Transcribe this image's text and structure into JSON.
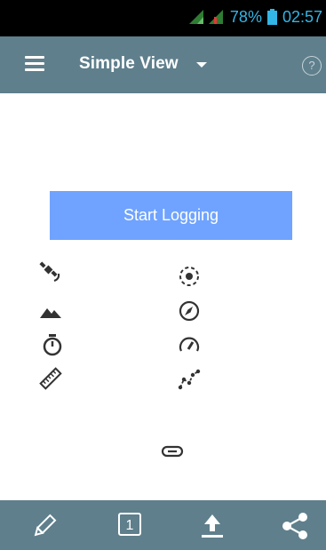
{
  "status_bar": {
    "battery": "78%",
    "time": "02:57"
  },
  "app_bar": {
    "title": "Simple View",
    "help": "?"
  },
  "main": {
    "start_button_label": "Start Logging",
    "icons_left": [
      "satellite-icon",
      "mountain-icon",
      "timer-icon",
      "ruler-icon"
    ],
    "icons_right": [
      "gps-fix-icon",
      "compass-icon",
      "speedometer-icon",
      "track-points-icon"
    ]
  },
  "bottom_bar": {
    "page_number": "1"
  },
  "colors": {
    "status_accent": "#33b5e5",
    "toolbar": "#5f7f8c",
    "start_button": "#6fa3ff"
  }
}
